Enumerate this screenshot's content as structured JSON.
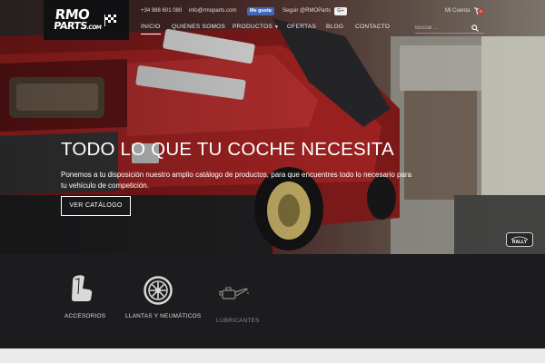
{
  "brand": {
    "logo_line1": "RMO",
    "logo_line2": "PARTS",
    "logo_suffix": ".COM"
  },
  "topbar": {
    "phone": "+34 988 601 080",
    "email": "info@rmoparts.com",
    "facebook_label": "Me gusta",
    "twitter_follow": "Seguir @RMOParts",
    "google_label": "G+",
    "account_label": "Mi Cuenta",
    "cart_count": "0"
  },
  "nav": {
    "items": [
      {
        "label": "INICIO"
      },
      {
        "label": "QUIENES SOMOS"
      },
      {
        "label": "PRODUCTOS"
      },
      {
        "label": "OFERTAS"
      },
      {
        "label": "BLOG"
      },
      {
        "label": "CONTACTO"
      }
    ],
    "search_placeholder": "Buscar ..."
  },
  "hero": {
    "title": "TODO LO QUE TU COCHE NECESITA",
    "description": "Ponemos a tu disposición nuestro amplio catálogo de productos, para que encuentres todo lo necesario para tu vehículo de competición.",
    "button_label": "VER CATÁLOGO",
    "badge_text": "RALLY"
  },
  "categories": [
    {
      "label": "ACCESORIOS",
      "icon": "seat-icon"
    },
    {
      "label": "LLANTAS Y NEUMÁTICOS",
      "icon": "wheel-icon"
    },
    {
      "label": "LUBRICANTES",
      "icon": "oil-can-icon"
    }
  ],
  "colors": {
    "accent_red": "#c0392b",
    "facebook_blue": "#4267b2",
    "dark_bg": "#1c1c1f"
  }
}
